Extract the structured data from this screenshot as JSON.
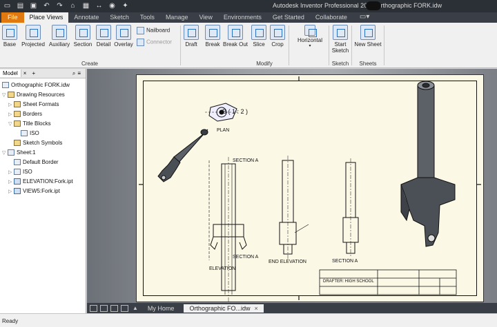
{
  "window": {
    "title": "Autodesk Inventor Professional 2019   Orthographic FORK.idw"
  },
  "quick_access": [
    "new-icon",
    "open-icon",
    "save-icon",
    "undo-icon",
    "redo-icon",
    "home-icon",
    "print-icon",
    "measure-icon",
    "appearance-icon",
    "update-icon"
  ],
  "tabs": {
    "file": "File",
    "items": [
      "Place Views",
      "Annotate",
      "Sketch",
      "Tools",
      "Manage",
      "View",
      "Environments",
      "Get Started",
      "Collaborate"
    ],
    "active": "Place Views"
  },
  "ribbon": {
    "create": {
      "label": "Create",
      "tools": [
        "Base",
        "Projected",
        "Auxiliary",
        "Section",
        "Detail",
        "Overlay"
      ],
      "small": [
        "Nailboard",
        "Connector"
      ]
    },
    "modify": {
      "label": "Modify",
      "tools": [
        "Draft",
        "Break",
        "Break Out",
        "Slice",
        "Crop"
      ],
      "align": "Horizontal"
    },
    "sketch": {
      "label": "Sketch",
      "tool": "Start\nSketch",
      "tool_line1": "Start",
      "tool_line2": "Sketch"
    },
    "sheets": {
      "label": "Sheets",
      "tool": "New Sheet"
    }
  },
  "browser": {
    "tab": "Model",
    "close": "×",
    "add": "+",
    "tree": [
      {
        "label": "Orthographic FORK.idw",
        "level": 0,
        "icon": "doc"
      },
      {
        "label": "Drawing Resources",
        "level": 1,
        "icon": "folder"
      },
      {
        "label": "Sheet Formats",
        "level": 2,
        "icon": "folder"
      },
      {
        "label": "Borders",
        "level": 2,
        "icon": "folder"
      },
      {
        "label": "Title Blocks",
        "level": 2,
        "icon": "folder"
      },
      {
        "label": "ISO",
        "level": 3,
        "icon": "doc"
      },
      {
        "label": "Sketch Symbols",
        "level": 2,
        "icon": "folder"
      },
      {
        "label": "Sheet:1",
        "level": 1,
        "icon": "doc"
      },
      {
        "label": "Default Border",
        "level": 2,
        "icon": "doc"
      },
      {
        "label": "ISO",
        "level": 2,
        "icon": "doc"
      },
      {
        "label": "ELEVATION:Fork.ipt",
        "level": 2,
        "icon": "part"
      },
      {
        "label": "VIEW5:Fork.ipt",
        "level": 2,
        "icon": "part"
      }
    ]
  },
  "drawing": {
    "detail_label": "B ( 1 : 2 )",
    "plan_label": "PLAN",
    "section_a_1": "SECTION A",
    "section_a_2": "SECTION A",
    "elevation_label": "ELEVATION",
    "end_elevation_label": "END ELEVATION",
    "section_a_view": "SECTION A",
    "title_block_drafter": "DRAFTER: HIGH SCHOOL"
  },
  "doc_tabs": {
    "items": [
      "My Home",
      "Orthographic FO...idw"
    ],
    "active": "Orthographic FO...idw",
    "close": "×"
  },
  "status": {
    "text": "Ready"
  },
  "colors": {
    "file_tab": "#e07a10",
    "title_bar": "#2b2f36",
    "sheet": "#fbf8e6"
  }
}
